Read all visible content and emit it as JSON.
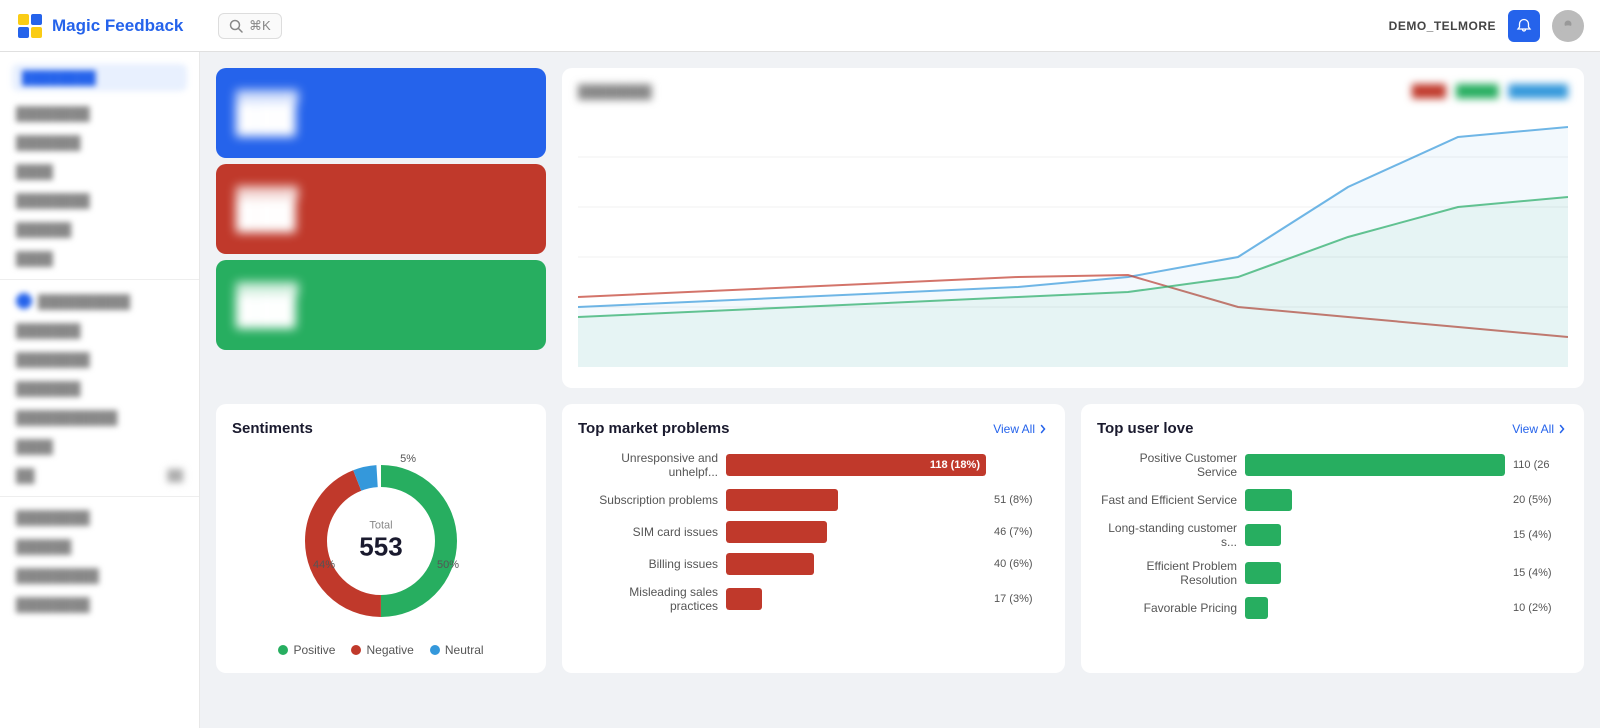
{
  "header": {
    "logo_brand": "Magic",
    "logo_product": "Feedback",
    "search_placeholder": "⌘K",
    "user_label": "DEMO_TELMORE",
    "notification_icon": "🔔"
  },
  "sidebar": {
    "items": [
      {
        "id": "overview",
        "label": "Overview",
        "active": true,
        "blurred": false
      },
      {
        "id": "sources",
        "label": "Sources",
        "active": false,
        "blurred": true
      },
      {
        "id": "topics",
        "label": "Topics",
        "active": false,
        "blurred": true
      },
      {
        "id": "rules",
        "label": "Rules",
        "active": false,
        "blurred": true
      },
      {
        "id": "tags",
        "label": "Tags",
        "active": false,
        "blurred": true
      },
      {
        "id": "settings",
        "label": "Settings",
        "active": false,
        "blurred": true
      },
      {
        "id": "team",
        "label": "Team",
        "active": false,
        "blurred": true
      },
      {
        "id": "integrations",
        "label": "Integrations",
        "active": false,
        "blurred": true
      },
      {
        "id": "feedback",
        "label": "Feedback",
        "active": false,
        "blurred": true
      },
      {
        "id": "alerts",
        "label": "Alerts",
        "active": false,
        "blurred": true
      },
      {
        "id": "reports",
        "label": "Reports",
        "active": false,
        "blurred": true
      }
    ]
  },
  "stats": {
    "card1": {
      "blurred": true
    },
    "card2": {
      "blurred": true
    },
    "card3": {
      "blurred": true
    }
  },
  "sentiments": {
    "title": "Sentiments",
    "total_label": "Total",
    "total_value": "553",
    "positive_pct": 50,
    "negative_pct": 44,
    "neutral_pct": 5,
    "label_positive": "50%",
    "label_negative": "44%",
    "label_neutral": "5%",
    "colors": {
      "positive": "#27ae60",
      "negative": "#c0392b",
      "neutral": "#3498db"
    },
    "legend": [
      {
        "label": "Positive",
        "color": "#27ae60"
      },
      {
        "label": "Negative",
        "color": "#c0392b"
      },
      {
        "label": "Neutral",
        "color": "#3498db"
      }
    ]
  },
  "market_problems": {
    "title": "Top market problems",
    "view_all": "View All",
    "bar_color": "#c0392b",
    "items": [
      {
        "label": "Unresponsive and unhelpf...",
        "value": 118,
        "pct": 18,
        "display": "118 (18%)",
        "width_pct": 100
      },
      {
        "label": "Subscription problems",
        "value": 51,
        "pct": 8,
        "display": "51 (8%)",
        "width_pct": 43
      },
      {
        "label": "SIM card issues",
        "value": 46,
        "pct": 7,
        "display": "46 (7%)",
        "width_pct": 39
      },
      {
        "label": "Billing issues",
        "value": 40,
        "pct": 6,
        "display": "40 (6%)",
        "width_pct": 34
      },
      {
        "label": "Misleading sales practices",
        "value": 17,
        "pct": 3,
        "display": "17 (3%)",
        "width_pct": 14
      }
    ]
  },
  "user_love": {
    "title": "Top user love",
    "view_all": "View All",
    "bar_color": "#27ae60",
    "items": [
      {
        "label": "Positive Customer Service",
        "value": 110,
        "pct": 26,
        "display": "110 (26",
        "width_pct": 100
      },
      {
        "label": "Fast and Efficient Service",
        "value": 20,
        "pct": 5,
        "display": "20 (5%)",
        "width_pct": 18
      },
      {
        "label": "Long-standing customer s...",
        "value": 15,
        "pct": 4,
        "display": "15 (4%)",
        "width_pct": 14
      },
      {
        "label": "Efficient Problem Resolution",
        "value": 15,
        "pct": 4,
        "display": "15 (4%)",
        "width_pct": 14
      },
      {
        "label": "Favorable Pricing",
        "value": 10,
        "pct": 2,
        "display": "10 (2%)",
        "width_pct": 9
      }
    ]
  }
}
